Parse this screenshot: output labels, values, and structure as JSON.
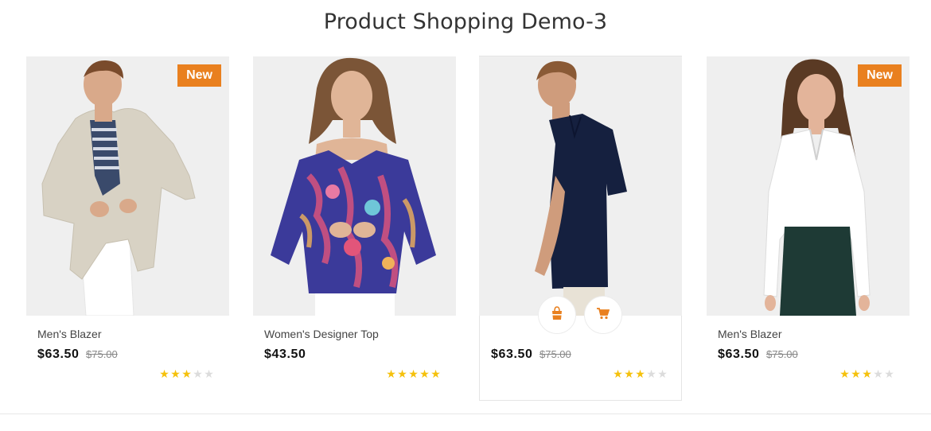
{
  "page": {
    "title": "Product Shopping Demo-3"
  },
  "colors": {
    "accent": "#e9801f",
    "star_on": "#f5c10c",
    "star_off": "#dcdcdc"
  },
  "products": [
    {
      "name": "Men's Blazer",
      "price": "$63.50",
      "old_price": "$75.00",
      "badge": "New",
      "rating": 3,
      "image": "man in beige blazer and white trousers"
    },
    {
      "name": "Women's Designer Top",
      "price": "$43.50",
      "old_price": "",
      "badge": "",
      "rating": 5,
      "image": "woman in colorful off-shoulder printed top"
    },
    {
      "name": "",
      "price": "$63.50",
      "old_price": "$75.00",
      "badge": "",
      "rating": 3,
      "image": "man in navy polo shirt",
      "actions": [
        "shopping-bag-icon",
        "cart-icon"
      ]
    },
    {
      "name": "Men's Blazer",
      "price": "$63.50",
      "old_price": "$75.00",
      "badge": "New",
      "rating": 3,
      "image": "woman in white blouse and dark green skirt"
    }
  ]
}
